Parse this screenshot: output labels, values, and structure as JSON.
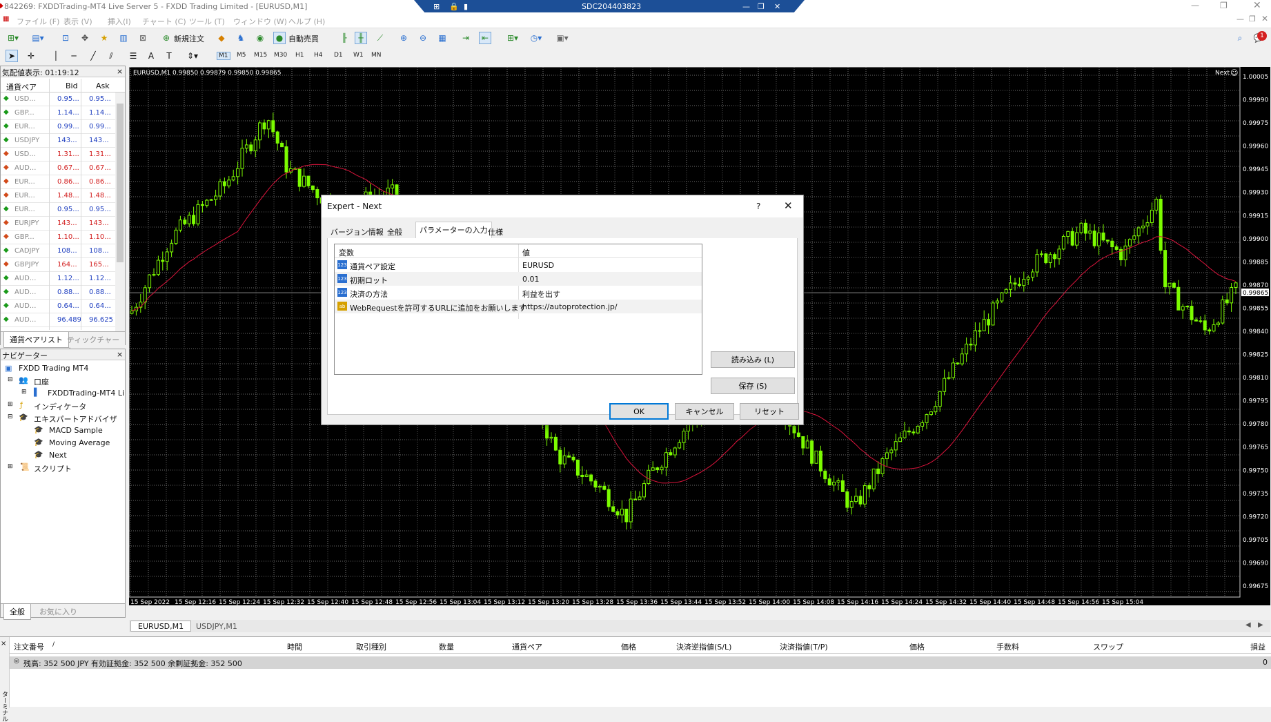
{
  "window": {
    "title": "842269: FXDDTrading-MT4 Live Server 5 - FXDD Trading Limited - [EURUSD,M1]",
    "rd_title": "SDC204403823"
  },
  "menu": [
    "ファイル (F)",
    "表示 (V)",
    "挿入(I)",
    "チャート (C)",
    "ツール (T)",
    "ウィンドウ (W)",
    "ヘルプ (H)"
  ],
  "toolbar": {
    "new_order": "新規注文",
    "auto_trade": "自動売買",
    "alert_count": "1"
  },
  "timeframes": [
    "M1",
    "M5",
    "M15",
    "M30",
    "H1",
    "H4",
    "D1",
    "W1",
    "MN"
  ],
  "market_watch": {
    "title": "気配値表示: 01:19:12",
    "headers": [
      "通貨ペア",
      "Bid",
      "Ask"
    ],
    "rows": [
      {
        "sym": "USD...",
        "bid": "0.95...",
        "ask": "0.95...",
        "dir": "up"
      },
      {
        "sym": "GBP...",
        "bid": "1.14...",
        "ask": "1.14...",
        "dir": "up"
      },
      {
        "sym": "EUR...",
        "bid": "0.99...",
        "ask": "0.99...",
        "dir": "up"
      },
      {
        "sym": "USDJPY",
        "bid": "143...",
        "ask": "143...",
        "dir": "up"
      },
      {
        "sym": "USD...",
        "bid": "1.31...",
        "ask": "1.31...",
        "dir": "down"
      },
      {
        "sym": "AUD...",
        "bid": "0.67...",
        "ask": "0.67...",
        "dir": "down"
      },
      {
        "sym": "EUR...",
        "bid": "0.86...",
        "ask": "0.86...",
        "dir": "down"
      },
      {
        "sym": "EUR...",
        "bid": "1.48...",
        "ask": "1.48...",
        "dir": "down"
      },
      {
        "sym": "EUR...",
        "bid": "0.95...",
        "ask": "0.95...",
        "dir": "up"
      },
      {
        "sym": "EURJPY",
        "bid": "143...",
        "ask": "143...",
        "dir": "down"
      },
      {
        "sym": "GBP...",
        "bid": "1.10...",
        "ask": "1.10...",
        "dir": "down"
      },
      {
        "sym": "CADJPY",
        "bid": "108...",
        "ask": "108...",
        "dir": "up"
      },
      {
        "sym": "GBPJPY",
        "bid": "164...",
        "ask": "165...",
        "dir": "down"
      },
      {
        "sym": "AUD...",
        "bid": "1.12...",
        "ask": "1.12...",
        "dir": "up"
      },
      {
        "sym": "AUD...",
        "bid": "0.88...",
        "ask": "0.88...",
        "dir": "up"
      },
      {
        "sym": "AUD...",
        "bid": "0.64...",
        "ask": "0.64...",
        "dir": "up"
      },
      {
        "sym": "AUD...",
        "bid": "96.489",
        "ask": "96.625",
        "dir": "up"
      }
    ],
    "tabs": [
      "通貨ペアリスト",
      "ティックチャート"
    ]
  },
  "navigator": {
    "title": "ナビゲーター",
    "items": [
      "FXDD Trading MT4",
      "口座",
      "FXDDTrading-MT4 Li",
      "インディケータ",
      "エキスパートアドバイザ",
      "MACD Sample",
      "Moving Average",
      "Next",
      "スクリプト"
    ],
    "tabs": [
      "全般",
      "お気に入り"
    ]
  },
  "chart": {
    "info": "EURUSD,M1  0.99850 0.99879 0.99850 0.99865",
    "ea_label": "Next",
    "current_price": "0.99865",
    "price_labels": [
      "1.00005",
      "0.99990",
      "0.99975",
      "0.99960",
      "0.99945",
      "0.99930",
      "0.99915",
      "0.99900",
      "0.99885",
      "0.99870",
      "0.99865",
      "0.99855",
      "0.99840",
      "0.99825",
      "0.99810",
      "0.99795",
      "0.99780",
      "0.99765",
      "0.99750",
      "0.99735",
      "0.99720",
      "0.99705",
      "0.99690",
      "0.99675"
    ],
    "time_labels": [
      "15 Sep 2022",
      "15 Sep 12:16",
      "15 Sep 12:24",
      "15 Sep 12:32",
      "15 Sep 12:40",
      "15 Sep 12:48",
      "15 Sep 12:56",
      "15 Sep 13:04",
      "15 Sep 13:12",
      "15 Sep 13:20",
      "15 Sep 13:28",
      "15 Sep 13:36",
      "15 Sep 13:44",
      "15 Sep 13:52",
      "15 Sep 14:00",
      "15 Sep 14:08",
      "15 Sep 14:16",
      "15 Sep 14:24",
      "15 Sep 14:32",
      "15 Sep 14:40",
      "15 Sep 14:48",
      "15 Sep 14:56",
      "15 Sep 15:04"
    ],
    "tabs": [
      "EURUSD,M1",
      "USDJPY,M1"
    ],
    "bull_color": "#7cfc00",
    "ma_color": "#dc143c"
  },
  "terminal": {
    "columns": [
      "注文番号",
      "時間",
      "取引種別",
      "数量",
      "通貨ペア",
      "価格",
      "決済逆指値(S/L)",
      "決済指値(T/P)",
      "価格",
      "手数料",
      "スワップ",
      "損益"
    ],
    "balance": "残高: 352 500 JPY  有効証拠金: 352 500  余剰証拠金: 352 500",
    "profit": "0",
    "side_label": "ターミナル"
  },
  "dialog": {
    "title": "Expert - Next",
    "help": "?",
    "tabs": [
      "バージョン情報",
      "全般",
      "パラメーターの入力",
      "仕様"
    ],
    "col_var": "変数",
    "col_val": "値",
    "params": [
      {
        "type": "123",
        "name": "通貨ペア設定",
        "value": "EURUSD"
      },
      {
        "type": "123",
        "name": "初期ロット",
        "value": "0.01"
      },
      {
        "type": "123",
        "name": "決済の方法",
        "value": "利益を出す"
      },
      {
        "type": "ab",
        "name": "WebRequestを許可するURLに追加をお願いします",
        "value": "https://autoprotection.jp/"
      }
    ],
    "load": "読み込み (L)",
    "save": "保存 (S)",
    "ok": "OK",
    "cancel": "キャンセル",
    "reset": "リセット"
  }
}
